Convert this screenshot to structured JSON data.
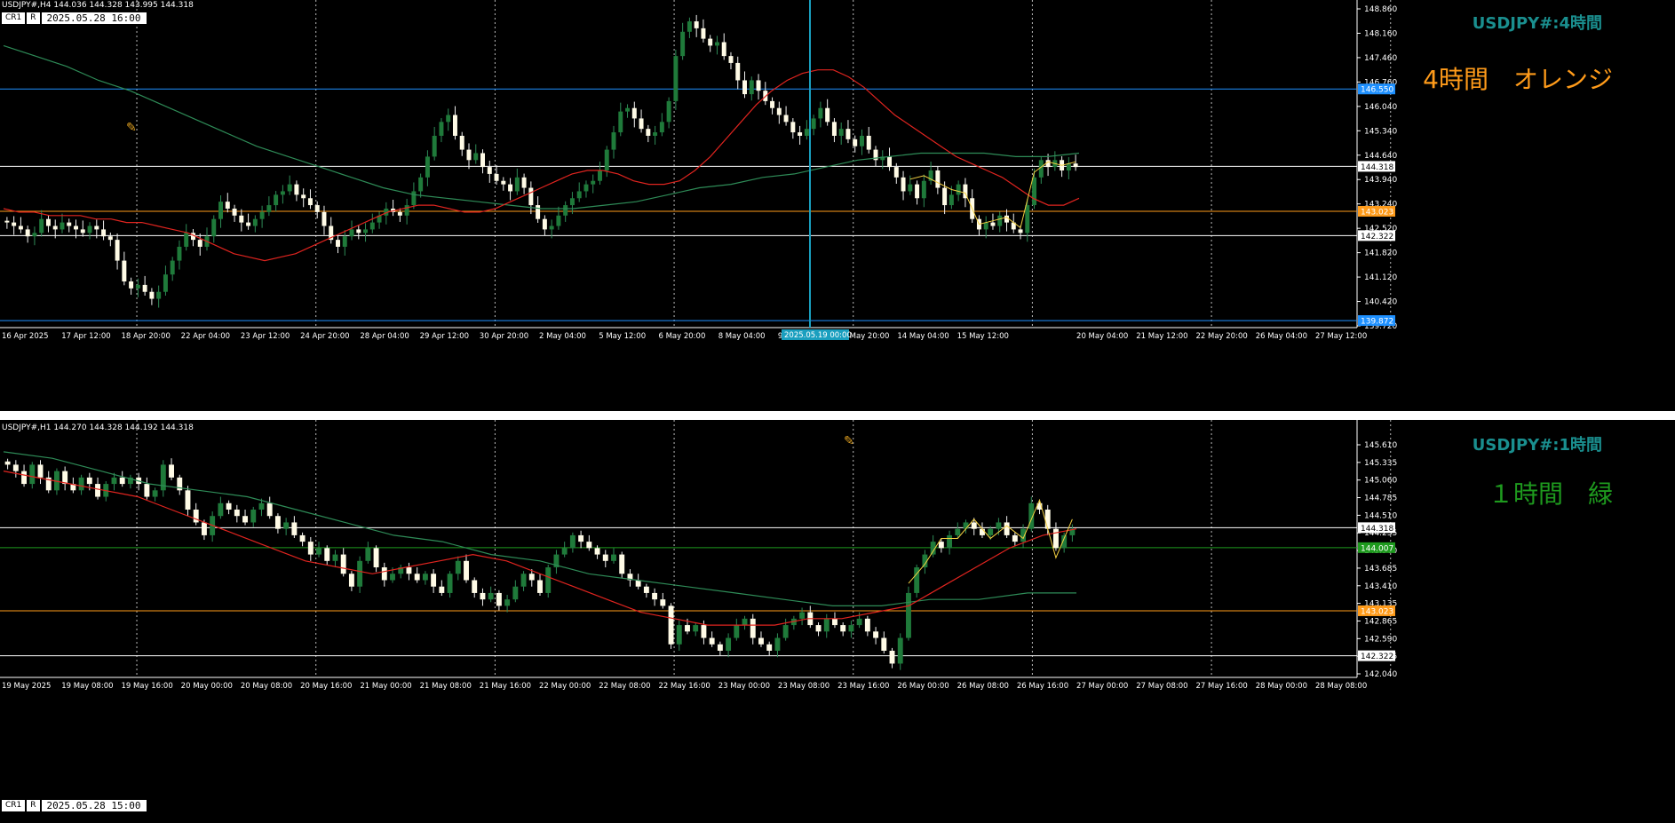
{
  "top": {
    "info": "USDJPY#,H4  144.036 144.328 143.995 144.318",
    "tags": [
      "CR1",
      "R"
    ],
    "datetime": "2025.05.28 16:00",
    "symbol_label": "USDJPY#:4時間",
    "note": "4時間　オレンジ",
    "note_color": "#ff9b1a",
    "cursor_time": "2025.05.19 00:00"
  },
  "bottom": {
    "info": "USDJPY#,H1  144.270 144.328 144.192 144.318",
    "tags": [
      "CR1",
      "R"
    ],
    "datetime": "2025.05.28 15:00",
    "symbol_label": "USDJPY#:1時間",
    "note": "１時間　緑",
    "note_color": "#1e9a1e"
  },
  "chart_data": [
    {
      "type": "candlestick",
      "timeframe": "H4",
      "ylim": [
        139.72,
        148.86
      ],
      "y_ticks": [
        "148.860",
        "148.160",
        "147.460",
        "146.760",
        "146.040",
        "145.340",
        "144.640",
        "143.940",
        "143.240",
        "142.520",
        "141.820",
        "141.120",
        "140.420",
        "139.720"
      ],
      "x_ticks": [
        "16 Apr 2025",
        "17 Apr 12:00",
        "18 Apr 20:00",
        "22 Apr 04:00",
        "23 Apr 12:00",
        "24 Apr 20:00",
        "28 Apr 04:00",
        "29 Apr 12:00",
        "30 Apr 20:00",
        "2 May 04:00",
        "5 May 12:00",
        "6 May 20:00",
        "8 May 04:00",
        "9 May 12:00",
        "12 May 20:00",
        "14 May 04:00",
        "15 May 12:00",
        "",
        "20 May 04:00",
        "21 May 12:00",
        "22 May 20:00",
        "26 May 04:00",
        "27 May 12:00"
      ],
      "levels": [
        {
          "value": 146.55,
          "label": "146.550",
          "color": "#1e90ff"
        },
        {
          "value": 144.318,
          "label": "144.318",
          "color": "#ffffff"
        },
        {
          "value": 143.023,
          "label": "143.023",
          "color": "#ff9b1a"
        },
        {
          "value": 142.322,
          "label": "142.322",
          "color": "#ffffff"
        },
        {
          "value": 139.872,
          "label": "139.872",
          "color": "#1e90ff"
        }
      ],
      "close": [
        142.7,
        142.6,
        142.5,
        142.3,
        142.4,
        142.8,
        142.6,
        142.5,
        142.7,
        142.6,
        142.5,
        142.4,
        142.6,
        142.5,
        142.3,
        142.2,
        141.6,
        141.0,
        140.8,
        140.9,
        140.7,
        140.5,
        140.7,
        141.2,
        141.6,
        142.0,
        142.4,
        142.2,
        142.0,
        142.3,
        142.8,
        143.3,
        143.1,
        142.9,
        142.7,
        142.6,
        142.8,
        143.0,
        143.2,
        143.5,
        143.6,
        143.8,
        143.5,
        143.4,
        143.2,
        143.0,
        142.6,
        142.2,
        142.0,
        142.3,
        142.5,
        142.4,
        142.5,
        142.7,
        142.9,
        143.1,
        143.0,
        142.9,
        143.2,
        143.6,
        144.0,
        144.6,
        145.2,
        145.6,
        145.8,
        145.2,
        144.8,
        144.5,
        144.7,
        144.3,
        144.1,
        143.9,
        143.8,
        143.6,
        144.0,
        143.7,
        143.2,
        142.8,
        142.5,
        142.6,
        142.9,
        143.2,
        143.4,
        143.6,
        143.8,
        143.9,
        144.2,
        144.8,
        145.3,
        145.9,
        146.0,
        145.7,
        145.4,
        145.2,
        145.3,
        145.6,
        146.2,
        147.5,
        148.2,
        148.5,
        148.3,
        148.0,
        147.8,
        147.9,
        147.5,
        147.3,
        146.8,
        146.4,
        146.8,
        146.5,
        146.2,
        146.0,
        145.8,
        145.6,
        145.3,
        145.2,
        145.4,
        145.7,
        146.0,
        145.6,
        145.2,
        145.4,
        145.1,
        144.9,
        145.2,
        144.8,
        144.5,
        144.6,
        144.3,
        144.0,
        143.6,
        143.8,
        143.4,
        143.9,
        144.2,
        143.7,
        143.2,
        143.5,
        143.8,
        143.4,
        142.8,
        142.5,
        142.7,
        142.6,
        142.9,
        142.7,
        142.5,
        142.4,
        143.2,
        144.0,
        144.5,
        144.3,
        144.5,
        144.2,
        144.4,
        144.3
      ],
      "ma_red": [
        143.1,
        143.0,
        143.0,
        142.9,
        142.9,
        142.9,
        142.8,
        142.8,
        142.7,
        142.7,
        142.6,
        142.5,
        142.4,
        142.2,
        142.0,
        141.8,
        141.7,
        141.6,
        141.7,
        141.8,
        142.0,
        142.2,
        142.4,
        142.6,
        142.8,
        143.0,
        143.1,
        143.2,
        143.2,
        143.1,
        143.0,
        143.0,
        143.1,
        143.3,
        143.5,
        143.7,
        143.9,
        144.1,
        144.2,
        144.2,
        144.1,
        143.9,
        143.8,
        143.8,
        143.9,
        144.2,
        144.6,
        145.1,
        145.6,
        146.1,
        146.5,
        146.8,
        147.0,
        147.1,
        147.1,
        146.9,
        146.6,
        146.2,
        145.8,
        145.5,
        145.2,
        144.9,
        144.6,
        144.4,
        144.2,
        144.0,
        143.7,
        143.4,
        143.2,
        143.2,
        143.4
      ],
      "ma_green": [
        147.8,
        147.5,
        147.2,
        146.8,
        146.5,
        146.1,
        145.7,
        145.3,
        144.9,
        144.6,
        144.3,
        144.0,
        143.7,
        143.5,
        143.4,
        143.3,
        143.2,
        143.1,
        143.1,
        143.2,
        143.3,
        143.5,
        143.7,
        143.8,
        144.0,
        144.1,
        144.3,
        144.5,
        144.6,
        144.7,
        144.7,
        144.7,
        144.6,
        144.6,
        144.7
      ]
    },
    {
      "type": "candlestick",
      "timeframe": "H1",
      "ylim": [
        142.04,
        145.61
      ],
      "y_ticks": [
        "145.610",
        "145.335",
        "145.060",
        "144.785",
        "144.510",
        "144.235",
        "143.960",
        "143.685",
        "143.410",
        "143.135",
        "142.865",
        "142.590",
        "142.315",
        "142.040"
      ],
      "x_ticks": [
        "19 May 2025",
        "19 May 08:00",
        "19 May 16:00",
        "20 May 00:00",
        "20 May 08:00",
        "20 May 16:00",
        "21 May 00:00",
        "21 May 08:00",
        "21 May 16:00",
        "22 May 00:00",
        "22 May 08:00",
        "22 May 16:00",
        "23 May 00:00",
        "23 May 08:00",
        "23 May 16:00",
        "26 May 00:00",
        "26 May 08:00",
        "26 May 16:00",
        "27 May 00:00",
        "27 May 08:00",
        "27 May 16:00",
        "28 May 00:00",
        "28 May 08:00"
      ],
      "levels": [
        {
          "value": 144.318,
          "label": "144.318",
          "color": "#ffffff"
        },
        {
          "value": 144.007,
          "label": "144.007",
          "color": "#1e9a1e"
        },
        {
          "value": 143.023,
          "label": "143.023",
          "color": "#ff9b1a"
        },
        {
          "value": 142.322,
          "label": "142.322",
          "color": "#ffffff"
        }
      ],
      "close": [
        145.3,
        145.2,
        145.0,
        145.3,
        145.1,
        144.9,
        145.2,
        145.0,
        144.9,
        145.1,
        145.0,
        144.8,
        145.0,
        145.1,
        145.0,
        145.1,
        145.0,
        144.8,
        144.9,
        145.3,
        145.1,
        144.9,
        144.6,
        144.4,
        144.2,
        144.5,
        144.7,
        144.6,
        144.5,
        144.4,
        144.6,
        144.7,
        144.5,
        144.3,
        144.4,
        144.2,
        144.1,
        143.9,
        144.0,
        143.8,
        143.9,
        143.6,
        143.4,
        143.8,
        144.0,
        143.7,
        143.5,
        143.6,
        143.7,
        143.6,
        143.5,
        143.6,
        143.4,
        143.3,
        143.6,
        143.8,
        143.5,
        143.3,
        143.2,
        143.3,
        143.1,
        143.2,
        143.4,
        143.6,
        143.5,
        143.3,
        143.7,
        143.9,
        144.0,
        144.2,
        144.1,
        144.0,
        143.9,
        143.8,
        143.9,
        143.6,
        143.5,
        143.4,
        143.3,
        143.2,
        143.1,
        142.5,
        142.8,
        142.7,
        142.8,
        142.6,
        142.5,
        142.4,
        142.6,
        142.8,
        142.9,
        142.6,
        142.5,
        142.4,
        142.6,
        142.8,
        142.9,
        143.0,
        142.8,
        142.7,
        142.9,
        142.8,
        142.7,
        142.8,
        142.9,
        142.7,
        142.6,
        142.4,
        142.2,
        142.6,
        143.3,
        143.7,
        143.9,
        144.1,
        144.0,
        144.2,
        144.3,
        144.4,
        144.3,
        144.2,
        144.3,
        144.4,
        144.2,
        144.1,
        144.3,
        144.7,
        144.6,
        144.3,
        144.0,
        144.2,
        144.3
      ],
      "ma_red": [
        145.2,
        145.1,
        145.0,
        144.9,
        144.8,
        144.6,
        144.4,
        144.2,
        144.0,
        143.8,
        143.7,
        143.6,
        143.7,
        143.8,
        143.9,
        143.8,
        143.6,
        143.4,
        143.2,
        143.0,
        142.9,
        142.8,
        142.8,
        142.8,
        142.9,
        142.9,
        143.0,
        143.1,
        143.4,
        143.7,
        144.0,
        144.2,
        144.3
      ],
      "ma_green": [
        145.5,
        145.4,
        145.2,
        145.0,
        144.9,
        144.8,
        144.6,
        144.4,
        144.2,
        144.1,
        143.9,
        143.8,
        143.6,
        143.5,
        143.4,
        143.3,
        143.2,
        143.1,
        143.1,
        143.2,
        143.2,
        143.3,
        143.3
      ]
    }
  ]
}
